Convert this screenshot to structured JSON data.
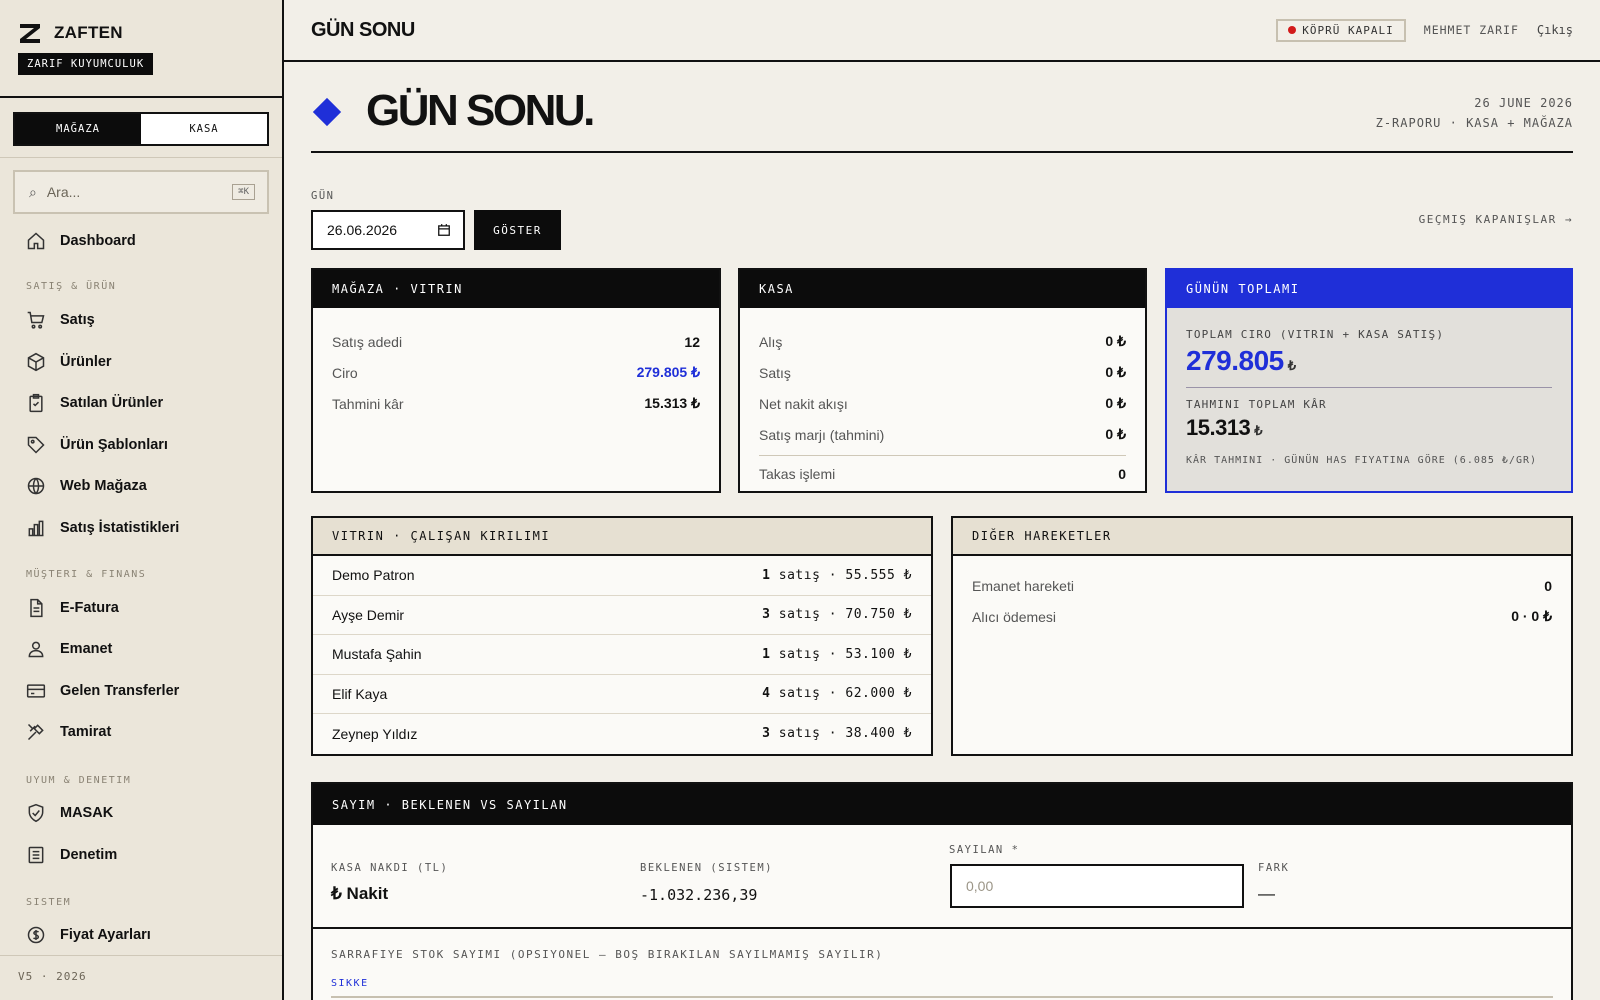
{
  "brand": {
    "name": "ZAFTEN",
    "subtitle": "ZARIF KUYUMCULUK"
  },
  "mode_tabs": {
    "store": "MAĞAZA",
    "cash": "KASA"
  },
  "search": {
    "placeholder": "Ara...",
    "shortcut": "⌘K"
  },
  "nav": {
    "dashboard": "Dashboard",
    "sections": {
      "sales": "SATIŞ & ÜRÜN",
      "customer": "MÜŞTERI & FINANS",
      "compliance": "UYUM & DENETIM",
      "system": "SISTEM"
    },
    "items": {
      "sales": "Satış",
      "products": "Ürünler",
      "sold_products": "Satılan Ürünler",
      "templates": "Ürün Şablonları",
      "web_store": "Web Mağaza",
      "stats": "Satış İstatistikleri",
      "einvoice": "E-Fatura",
      "consignment": "Emanet",
      "transfers": "Gelen Transferler",
      "repair": "Tamirat",
      "masak": "MASAK",
      "audit": "Denetim",
      "prices": "Fiyat Ayarları"
    }
  },
  "version": "V5 · 2026",
  "topbar": {
    "title": "GÜN SONU",
    "bridge_status": "KÖPRÜ KAPALI",
    "user": "MEHMET ZARIF",
    "logout": "Çıkış"
  },
  "hero": {
    "title": "GÜN SONU.",
    "date": "26 JUNE 2026",
    "subtitle": "Z-RAPORU · KASA + MAĞAZA"
  },
  "filter": {
    "label": "GÜN",
    "date_value": "26.06.2026",
    "show_button": "GÖSTER",
    "history_link": "GEÇMIŞ KAPANIŞLAR →"
  },
  "store_card": {
    "title": "MAĞAZA · VITRIN",
    "rows": [
      {
        "label": "Satış adedi",
        "value": "12"
      },
      {
        "label": "Ciro",
        "value": "279.805 ₺"
      },
      {
        "label": "Tahmini kâr",
        "value": "15.313 ₺"
      }
    ]
  },
  "cash_card": {
    "title": "KASA",
    "rows": [
      {
        "label": "Alış",
        "value": "0 ₺"
      },
      {
        "label": "Satış",
        "value": "0 ₺"
      },
      {
        "label": "Net nakit akışı",
        "value": "0 ₺"
      },
      {
        "label": "Satış marjı (tahmini)",
        "value": "0 ₺"
      }
    ],
    "swap": {
      "label": "Takas işlemi",
      "value": "0"
    }
  },
  "total_card": {
    "title": "GÜNÜN TOPLAMI",
    "revenue_label": "TOPLAM CIRO (VITRIN + KASA SATIŞ)",
    "revenue_value": "279.805",
    "profit_label": "TAHMINI TOPLAM KÂR",
    "profit_value": "15.313",
    "currency": "₺",
    "note": "KÂR TAHMINI · GÜNÜN HAS FIYATINA GÖRE (6.085 ₺/GR)"
  },
  "employees_card": {
    "title": "VITRIN · ÇALIŞAN KIRILIMI",
    "rows": [
      {
        "name": "Demo Patron",
        "count": "1",
        "detail": "satış · 55.555 ₺"
      },
      {
        "name": "Ayşe Demir",
        "count": "3",
        "detail": "satış · 70.750 ₺"
      },
      {
        "name": "Mustafa Şahin",
        "count": "1",
        "detail": "satış · 53.100 ₺"
      },
      {
        "name": "Elif Kaya",
        "count": "4",
        "detail": "satış · 62.000 ₺"
      },
      {
        "name": "Zeynep Yıldız",
        "count": "3",
        "detail": "satış · 38.400 ₺"
      }
    ]
  },
  "other_card": {
    "title": "DIĞER HAREKETLER",
    "rows": [
      {
        "label": "Emanet hareketi",
        "value": "0"
      },
      {
        "label": "Alıcı ödemesi",
        "value": "0 · 0 ₺"
      }
    ]
  },
  "count_card": {
    "title": "SAYIM · BEKLENEN VS SAYILAN",
    "cash_label": "KASA NAKDI (TL)",
    "cash_value": "₺ Nakit",
    "expected_label": "BEKLENEN (SISTEM)",
    "expected_value": "-1.032.236,39",
    "counted_label": "SAYILAN *",
    "counted_placeholder": "0,00",
    "diff_label": "FARK",
    "diff_value": "—",
    "stock_note": "SARRAFIYE STOK SAYIMI (OPSIYONEL — BOŞ BIRAKILAN SAYILMAMIŞ SAYILIR)",
    "coin_label": "SIKKE"
  },
  "colors": {
    "accent": "#1f2fd8",
    "dark": "#0c0c0c",
    "alert": "#d21a1a",
    "paper": "#f2efe8"
  }
}
